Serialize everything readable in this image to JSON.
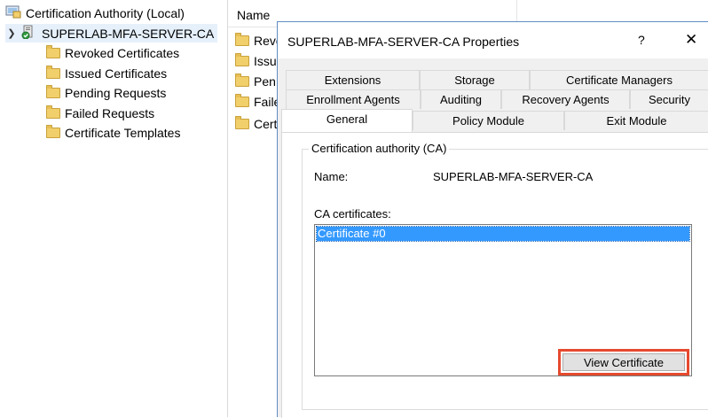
{
  "tree": {
    "root_label": "Certification Authority (Local)",
    "server_label": "SUPERLAB-MFA-SERVER-CA",
    "children": [
      "Revoked Certificates",
      "Issued Certificates",
      "Pending Requests",
      "Failed Requests",
      "Certificate Templates"
    ]
  },
  "list": {
    "header": "Name",
    "items": [
      "Revo",
      "Issu",
      "Pen",
      "Faile",
      "Cert"
    ]
  },
  "dialog": {
    "title": "SUPERLAB-MFA-SERVER-CA Properties",
    "help": "?",
    "close": "✕",
    "tabs_row1": [
      "Extensions",
      "Storage",
      "Certificate Managers"
    ],
    "tabs_row2": [
      "Enrollment Agents",
      "Auditing",
      "Recovery Agents",
      "Security"
    ],
    "tabs_row3": [
      "General",
      "Policy Module",
      "Exit Module"
    ],
    "active_tab": "General",
    "group_title": "Certification authority (CA)",
    "name_label": "Name:",
    "name_value": "SUPERLAB-MFA-SERVER-CA",
    "ca_certs_label": "CA certificates:",
    "ca_certs": [
      "Certificate #0"
    ],
    "view_cert_button": "View Certificate"
  },
  "colors": {
    "selection": "#3399ff",
    "highlight_box": "#e64a2f",
    "tree_selection": "#e5f0fb"
  }
}
